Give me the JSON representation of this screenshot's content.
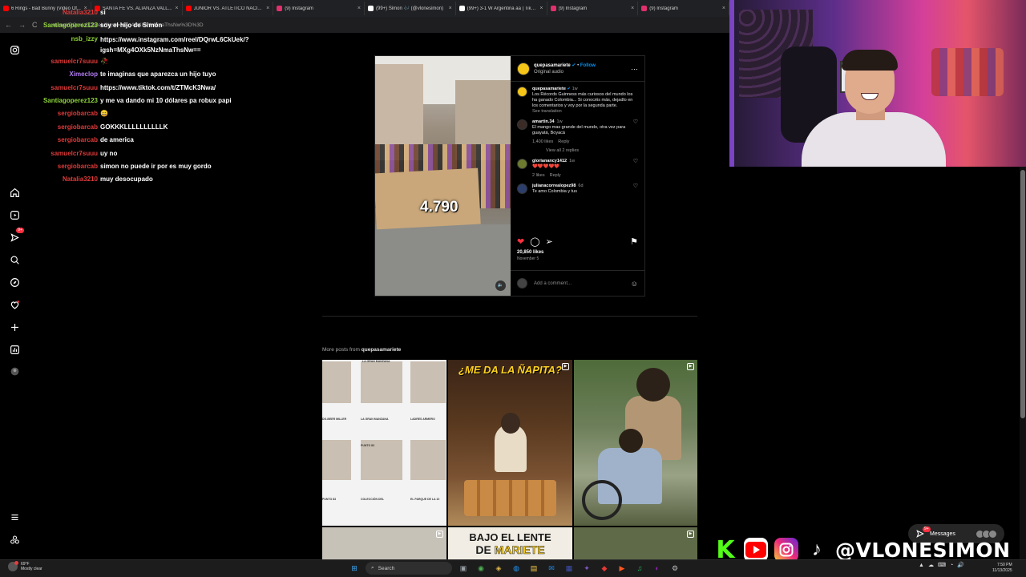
{
  "browser": {
    "tabs": [
      {
        "title": "6 Rings - Bad Bunny (Video Of...",
        "color": "#ff0000"
      },
      {
        "title": "SANTA FE VS. ALIANZA VALL...",
        "color": "#ff0000"
      },
      {
        "title": "JUNIOR VS. ATLÉTICO NACI...",
        "color": "#ff0000"
      },
      {
        "title": "(9) Instagram",
        "color": "#e1306c"
      },
      {
        "title": "(99+) Simon 🎶 (@vlonesimon)",
        "color": "#ffffff"
      },
      {
        "title": "(99+) 3-1 W Argentina aa | TikT...",
        "color": "#ffffff"
      },
      {
        "title": "(9) Instagram",
        "color": "#e1306c"
      },
      {
        "title": "(9) Instagram",
        "color": "#e1306c"
      }
    ],
    "close_glyph": "×",
    "back_glyph": "←",
    "forward_glyph": "→",
    "reload_glyph": "C",
    "url": "...m/reel/DQrwL6CkUek/?igsh=MXg4OXk5NzNmaThsNw%3D%3D"
  },
  "chat": [
    {
      "user": "Natalia3210",
      "text": "si",
      "color": "red"
    },
    {
      "user": "Santiagoperez123",
      "text": "soy el hijo de Simón",
      "color": "green"
    },
    {
      "user": "nsb_izzy",
      "text": "https://www.instagram.com/reel/DQrwL6CkUek/?igsh=MXg4OXk5NzNmaThsNw==",
      "color": "lime",
      "wrap": true
    },
    {
      "user": "samuelcr7suuu",
      "text": "🥀",
      "color": "red"
    },
    {
      "user": "Ximeclop",
      "text": "te imaginas que aparezca un hijo tuyo",
      "color": "purple"
    },
    {
      "user": "samuelcr7suuu",
      "text": "https://www.tiktok.com/t/ZTMcK3Nwa/",
      "color": "red"
    },
    {
      "user": "Santiagoperez123",
      "text": "y me va dando mi 10 dólares pa robux papi",
      "color": "green"
    },
    {
      "user": "sergiobarcab",
      "text": "😄",
      "color": "red"
    },
    {
      "user": "sergiobarcab",
      "text": "GOKKKLLLLLLLLLLK",
      "color": "red"
    },
    {
      "user": "sergiobarcab",
      "text": "de america",
      "color": "red"
    },
    {
      "user": "samuelcr7suuu",
      "text": "uy no",
      "color": "red"
    },
    {
      "user": "sergiobarcab",
      "text": "simon no puede ir por es muy gordo",
      "color": "red"
    },
    {
      "user": "Natalia3210",
      "text": "muy desocupado",
      "color": "red"
    }
  ],
  "sidebar": {
    "items": [
      {
        "name": "instagram-icon"
      },
      {
        "name": "home-icon"
      },
      {
        "name": "reels-icon"
      },
      {
        "name": "explore-icon"
      },
      {
        "name": "search-icon"
      },
      {
        "name": "messenger-icon"
      },
      {
        "name": "notifications-icon"
      },
      {
        "name": "create-icon"
      },
      {
        "name": "dashboard-icon"
      },
      {
        "name": "profile-icon"
      },
      {
        "name": "menu-icon"
      },
      {
        "name": "threads-icon"
      }
    ],
    "badge": "9+"
  },
  "post": {
    "username": "quepasamariete",
    "verified_glyph": "✔",
    "follow": "Follow",
    "audio": "Original audio",
    "more_glyph": "···",
    "overlay_number": "4.790",
    "mute_glyph": "🔈",
    "caption_user": "quepasamariete",
    "caption_time": "1w",
    "caption": "Los Récords Guinness más curiosos del mundo los ha ganado Colombia... Si conocéis más, dejadlo en los comentarios y voy por la segunda parte.",
    "see_translation": "See translation",
    "comments": [
      {
        "user": "amartin.34",
        "time": "1w",
        "text": "El mango mas grande del mundo, otra vez para guayatá, Boyacá",
        "likes": "1,400 likes",
        "reply": "Reply",
        "avatar": "dark"
      },
      {
        "user": "glorianancy1412",
        "time": "1w",
        "text": "❤️❤️❤️❤️❤️",
        "likes": "2 likes",
        "reply": "Reply",
        "avatar": "green"
      },
      {
        "user": "julianacorrealopez98",
        "time": "6d",
        "text": "Te amo Colombia y tus",
        "likes": "",
        "reply": "",
        "avatar": "blue"
      }
    ],
    "view_replies": "View all 2 replies",
    "likes": "20,850 likes",
    "date": "November 5",
    "add_comment": "Add a comment...",
    "heart_glyph": "♡",
    "like_glyph": "❤",
    "comment_glyph": "◯",
    "share_glyph": "➢",
    "save_glyph": "⚑",
    "smile_glyph": "☺"
  },
  "more_posts": {
    "prefix": "More posts from",
    "user": "quepasamariete"
  },
  "grid": {
    "tile1_captions": [
      "LA GRAN MANZANA",
      "DG-BEER MILLER",
      "LA GRAN MANZANA",
      "LADRES ARMERO",
      "PUNTO 83",
      "PUNTO 83",
      "COLECCIÓN DEL",
      "EL PARQUE DE LA 10"
    ],
    "tile2_headline": "¿ME DA LA ÑAPITA?",
    "tile5_line1": "BAJO EL LENTE",
    "tile5_line2_a": "DE ",
    "tile5_line2_b": "MARIETE",
    "reel_glyph": "▶"
  },
  "overlay": {
    "kick": "K",
    "tiktok": "♪",
    "handle": "@VLONESIMON"
  },
  "messages": {
    "label": "Messages",
    "badge": "9+"
  },
  "taskbar": {
    "temp": "69°F",
    "weather": "Mostly clear",
    "search": "Search",
    "start_glyph": "⊞",
    "search_glyph": "⌕",
    "time": "7:50 PM",
    "date": "11/13/2025",
    "tray_glyphs": [
      "▲",
      "☁",
      "⌨",
      "◔",
      "🔊"
    ],
    "apps": [
      "▣",
      "◉",
      "◈",
      "◍",
      "▤",
      "✉",
      "▦",
      "✦",
      "◆",
      "▶",
      "♫",
      "◐",
      "⚙"
    ]
  }
}
